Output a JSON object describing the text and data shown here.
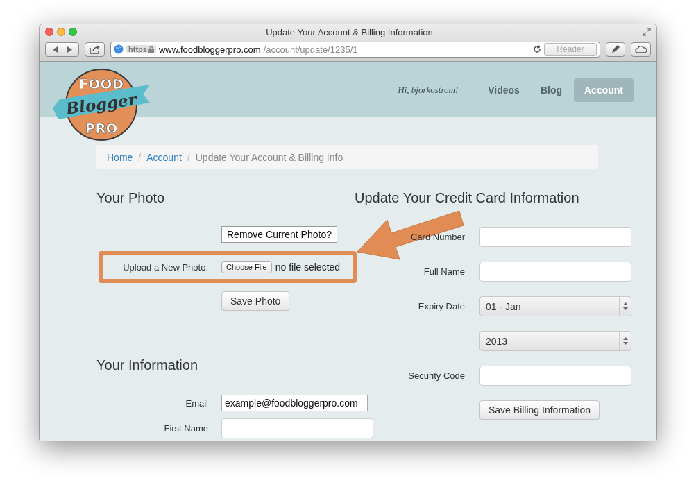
{
  "window": {
    "title": "Update Your Account & Billing Information"
  },
  "toolbar": {
    "scheme": "https",
    "host": "www.foodbloggerpro.com",
    "path": "/account/update/1235/1",
    "reader": "Reader"
  },
  "site": {
    "logo": {
      "line_1": "FOOD",
      "line_2": "Blogger",
      "line_3": "PRO"
    },
    "greeting": "Hi, bjorkostrom!",
    "nav": [
      {
        "label": "Videos",
        "selected": false
      },
      {
        "label": "Blog",
        "selected": false
      },
      {
        "label": "Account",
        "selected": true
      }
    ]
  },
  "breadcrumb": {
    "separator": "/",
    "items": [
      {
        "label": "Home",
        "kind": "link"
      },
      {
        "label": "Account",
        "kind": "link"
      },
      {
        "label": "Update Your Account & Billing Info",
        "kind": "current"
      }
    ]
  },
  "photo_section": {
    "title": "Your Photo",
    "remove_button": "Remove Current Photo?",
    "upload": {
      "label": "Upload a New Photo:",
      "button": "Choose File",
      "status": "no file selected"
    },
    "save_button": "Save Photo"
  },
  "info_section": {
    "title": "Your Information",
    "fields": [
      {
        "label": "Email",
        "value": "example@foodbloggerpro.com"
      },
      {
        "label": "First Name"
      }
    ]
  },
  "billing": {
    "title": "Update Your Credit Card Information",
    "fields": [
      {
        "kind": "input",
        "label": "Card Number"
      },
      {
        "kind": "input",
        "label": "Full Name"
      },
      {
        "kind": "select",
        "label": "Expiry Date",
        "value": "01 - Jan"
      },
      {
        "kind": "select",
        "value": "2013"
      },
      {
        "kind": "input",
        "label": "Security Code"
      }
    ],
    "save_button": "Save Billing Information"
  }
}
